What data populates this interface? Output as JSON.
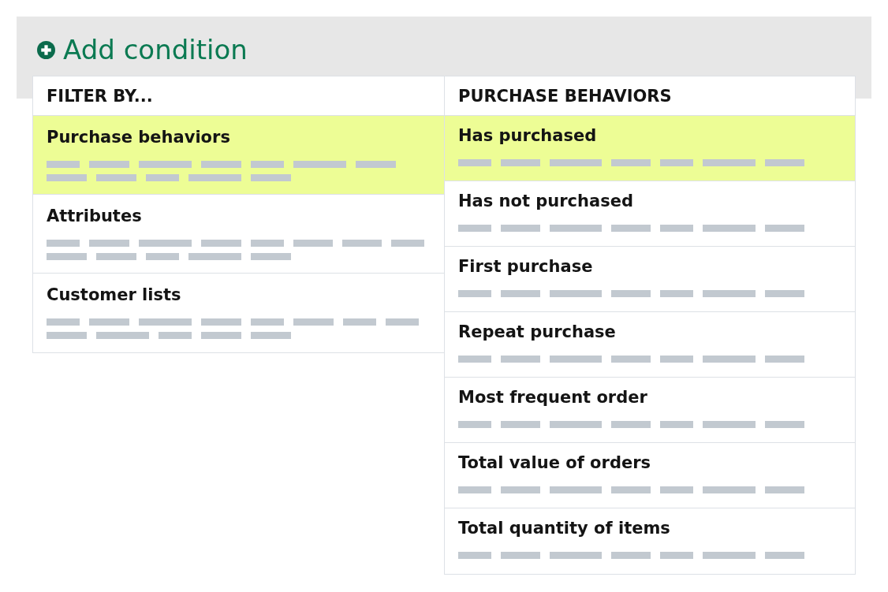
{
  "add_condition": {
    "label": "Add condition"
  },
  "filter_by": {
    "heading": "FILTER BY...",
    "items": [
      {
        "label": "Purchase behaviors",
        "selected": true
      },
      {
        "label": "Attributes",
        "selected": false
      },
      {
        "label": "Customer lists",
        "selected": false
      }
    ]
  },
  "purchase_behaviors": {
    "heading": "PURCHASE BEHAVIORS",
    "items": [
      {
        "label": "Has purchased",
        "selected": true
      },
      {
        "label": "Has not purchased",
        "selected": false
      },
      {
        "label": "First purchase",
        "selected": false
      },
      {
        "label": "Repeat purchase",
        "selected": false
      },
      {
        "label": "Most frequent order",
        "selected": false
      },
      {
        "label": "Total value of orders",
        "selected": false
      },
      {
        "label": "Total quantity of items",
        "selected": false
      }
    ]
  }
}
